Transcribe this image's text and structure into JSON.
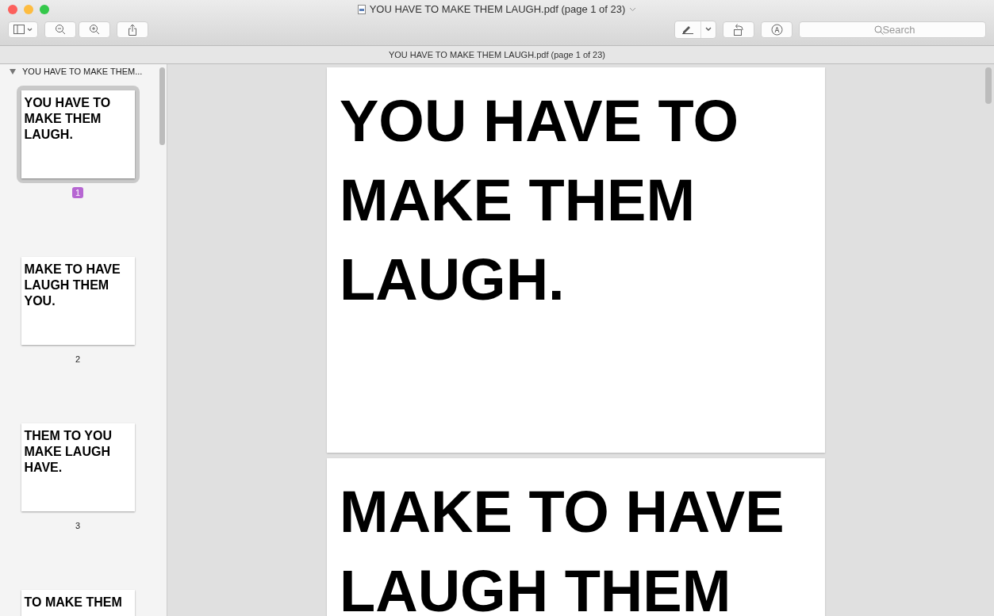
{
  "window": {
    "title": "YOU HAVE TO MAKE THEM LAUGH.pdf (page 1 of 23)"
  },
  "toolbar": {
    "search": {
      "placeholder": "Search"
    }
  },
  "path_bar": {
    "title": "YOU HAVE TO MAKE THEM LAUGH.pdf (page 1 of 23)"
  },
  "sidebar": {
    "outline_title": "YOU HAVE TO MAKE THEM...",
    "expanded": true,
    "thumbnails": [
      {
        "lines": [
          "YOU HAVE TO",
          "MAKE THEM",
          "LAUGH."
        ],
        "page": "1",
        "selected": true
      },
      {
        "lines": [
          "MAKE TO HAVE",
          "LAUGH THEM",
          "YOU."
        ],
        "page": "2",
        "selected": false
      },
      {
        "lines": [
          "THEM TO YOU",
          "MAKE LAUGH",
          "HAVE."
        ],
        "page": "3",
        "selected": false
      },
      {
        "lines": [
          "TO MAKE THEM"
        ],
        "selected": false
      }
    ]
  },
  "pages": [
    {
      "lines": [
        "YOU HAVE TO",
        "MAKE THEM",
        "LAUGH."
      ]
    },
    {
      "lines": [
        "MAKE TO HAVE",
        "LAUGH THEM"
      ]
    }
  ]
}
